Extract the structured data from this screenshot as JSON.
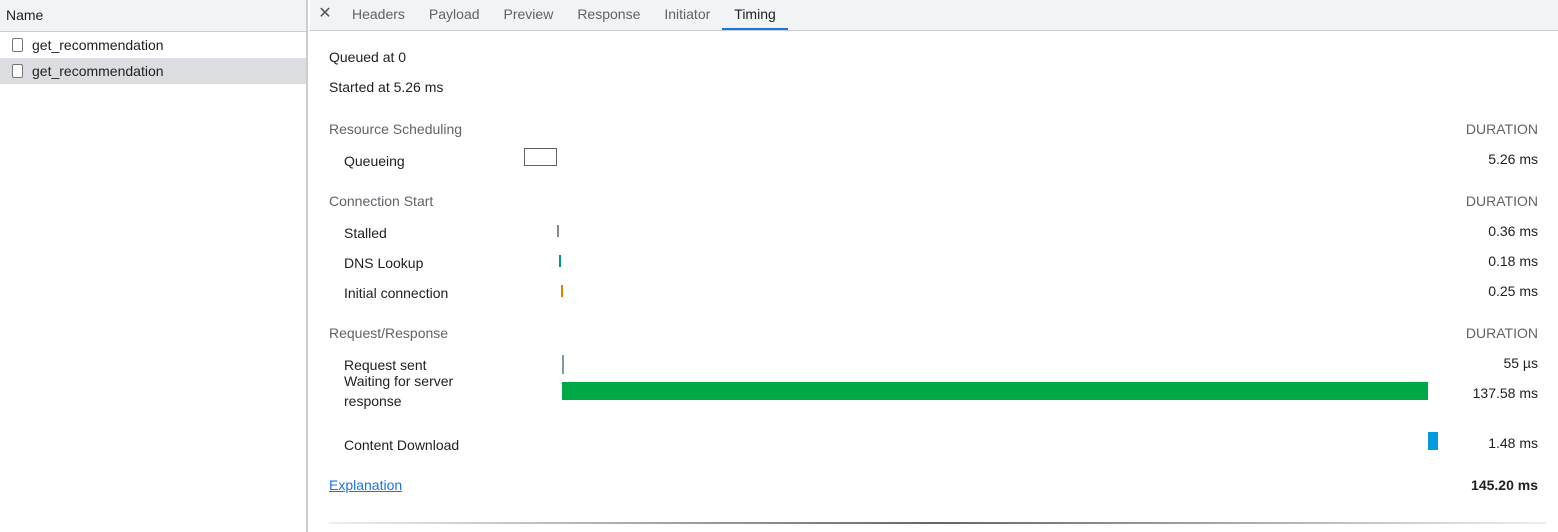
{
  "requests": {
    "header": "Name",
    "items": [
      {
        "name": "get_recommendation",
        "selected": false
      },
      {
        "name": "get_recommendation",
        "selected": true
      }
    ]
  },
  "tabs": {
    "close_icon": "close-icon",
    "items": [
      "Headers",
      "Payload",
      "Preview",
      "Response",
      "Initiator",
      "Timing"
    ],
    "active": "Timing"
  },
  "timing": {
    "queued": "Queued at 0",
    "started": "Started at 5.26 ms",
    "duration_label": "DURATION",
    "sections": [
      {
        "title": "Resource Scheduling",
        "rows": [
          {
            "label": "Queueing",
            "value": "5.26 ms",
            "ms": 5.26,
            "color": "#ffffff",
            "outline": "#5f6368"
          }
        ]
      },
      {
        "title": "Connection Start",
        "rows": [
          {
            "label": "Stalled",
            "value": "0.36 ms",
            "ms": 0.36,
            "color": "#888888"
          },
          {
            "label": "DNS Lookup",
            "value": "0.18 ms",
            "ms": 0.18,
            "color": "#009688"
          },
          {
            "label": "Initial connection",
            "value": "0.25 ms",
            "ms": 0.25,
            "color": "#e08000"
          }
        ]
      },
      {
        "title": "Request/Response",
        "rows": [
          {
            "label": "Request sent",
            "value": "55 µs",
            "ms": 0.055,
            "color": "#7a9e9f"
          },
          {
            "label": "Waiting for server response",
            "value": "137.58 ms",
            "ms": 137.58,
            "color": "#00a846"
          },
          {
            "label": "Content Download",
            "value": "1.48 ms",
            "ms": 1.48,
            "color": "#0299de"
          }
        ]
      }
    ],
    "explanation": "Explanation",
    "total": "145.20 ms",
    "total_ms": 145.2
  }
}
